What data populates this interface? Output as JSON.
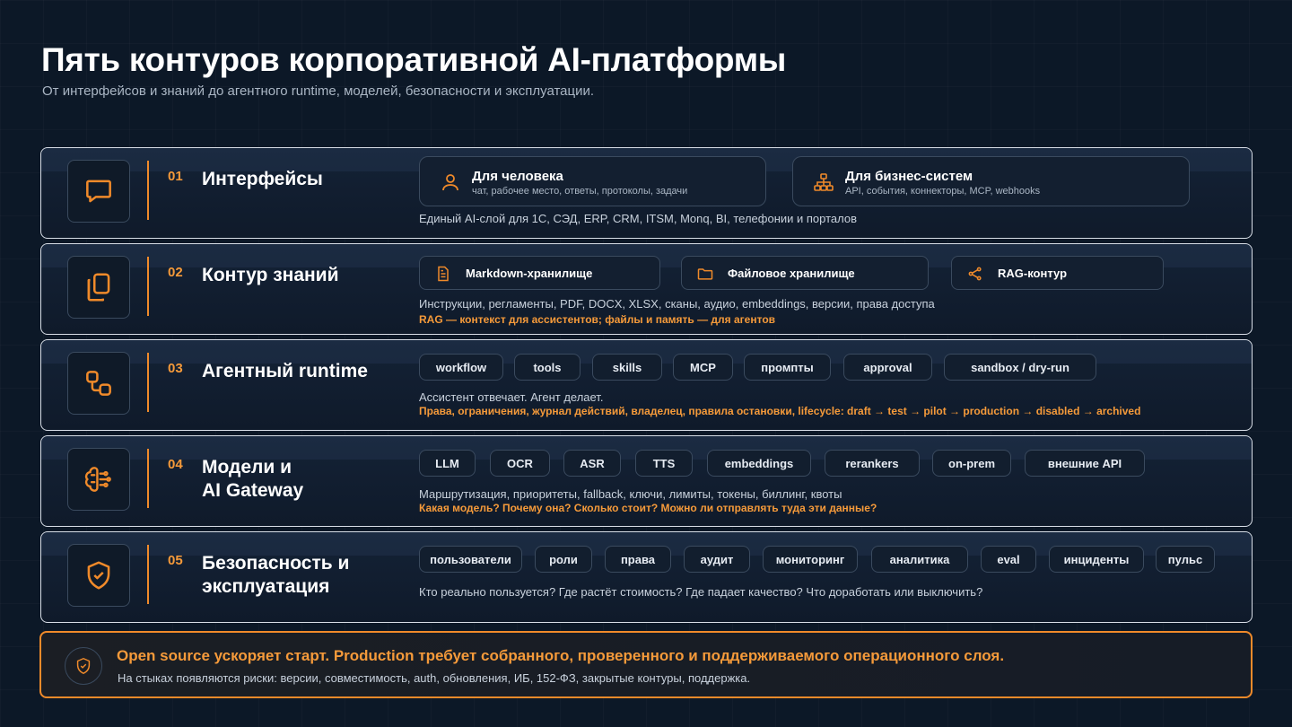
{
  "header": {
    "title": "Пять контуров корпоративной AI-платформы",
    "subtitle": "От интерфейсов и знаний до агентного runtime, моделей, безопасности и эксплуатации."
  },
  "colors": {
    "accent": "#f08a2a",
    "background": "#0c1827",
    "border": "#d7dde6"
  },
  "rows": [
    {
      "num": "01",
      "title": "Интерфейсы",
      "icon": "chat-bubble-icon",
      "cards": [
        {
          "title": "Для человека",
          "sub": "чат, рабочее место, ответы, протоколы, задачи",
          "icon": "user-icon"
        },
        {
          "title": "Для бизнес-систем",
          "sub": "API, события, коннекторы, MCP, webhooks",
          "icon": "hierarchy-icon"
        }
      ],
      "desc": "Единый AI-слой для 1С, СЭД, ERP, CRM, ITSM, Monq, BI, телефонии и порталов"
    },
    {
      "num": "02",
      "title": "Контур знаний",
      "icon": "documents-icon",
      "cards": [
        {
          "title": "Markdown-хранилище",
          "icon": "document-icon"
        },
        {
          "title": "Файловое хранилище",
          "icon": "folder-icon"
        },
        {
          "title": "RAG-контур",
          "icon": "share-nodes-icon"
        }
      ],
      "desc": "Инструкции, регламенты, PDF, DOCX, XLSX, сканы, аудио, embeddings, версии, права доступа",
      "highlight": "RAG — контекст для ассистентов; файлы и память — для агентов"
    },
    {
      "num": "03",
      "title": "Агентный runtime",
      "icon": "workflow-icon",
      "chips": [
        "workflow",
        "tools",
        "skills",
        "MCP",
        "промпты",
        "approval",
        "sandbox / dry-run"
      ],
      "desc": "Ассистент отвечает. Агент делает.",
      "highlight": "Права, ограничения, журнал действий, владелец, правила остановки, lifecycle: draft → test → pilot → production → disabled → archived"
    },
    {
      "num": "04",
      "title_line1": "Модели и",
      "title_line2": "AI Gateway",
      "icon": "brain-icon",
      "chips": [
        "LLM",
        "OCR",
        "ASR",
        "TTS",
        "embeddings",
        "rerankers",
        "on-prem",
        "внешние API"
      ],
      "desc": "Маршрутизация, приоритеты, fallback, ключи, лимиты, токены, биллинг, квоты",
      "highlight": "Какая модель? Почему она? Сколько стоит? Можно ли отправлять туда эти данные?"
    },
    {
      "num": "05",
      "title_line1": "Безопасность и",
      "title_line2": "эксплуатация",
      "icon": "shield-check-icon",
      "chips": [
        "пользователи",
        "роли",
        "права",
        "аудит",
        "мониторинг",
        "аналитика",
        "eval",
        "инциденты",
        "пульс"
      ],
      "desc": "Кто реально пользуется? Где растёт стоимость? Где падает качество? Что доработать или выключить?"
    }
  ],
  "footer": {
    "icon": "shield-check-icon",
    "title": "Open source ускоряет старт. Production требует собранного, проверенного и поддерживаемого операционного слоя.",
    "sub": "На стыках появляются риски: версии, совместимость, auth, обновления, ИБ, 152-ФЗ, закрытые контуры, поддержка."
  }
}
